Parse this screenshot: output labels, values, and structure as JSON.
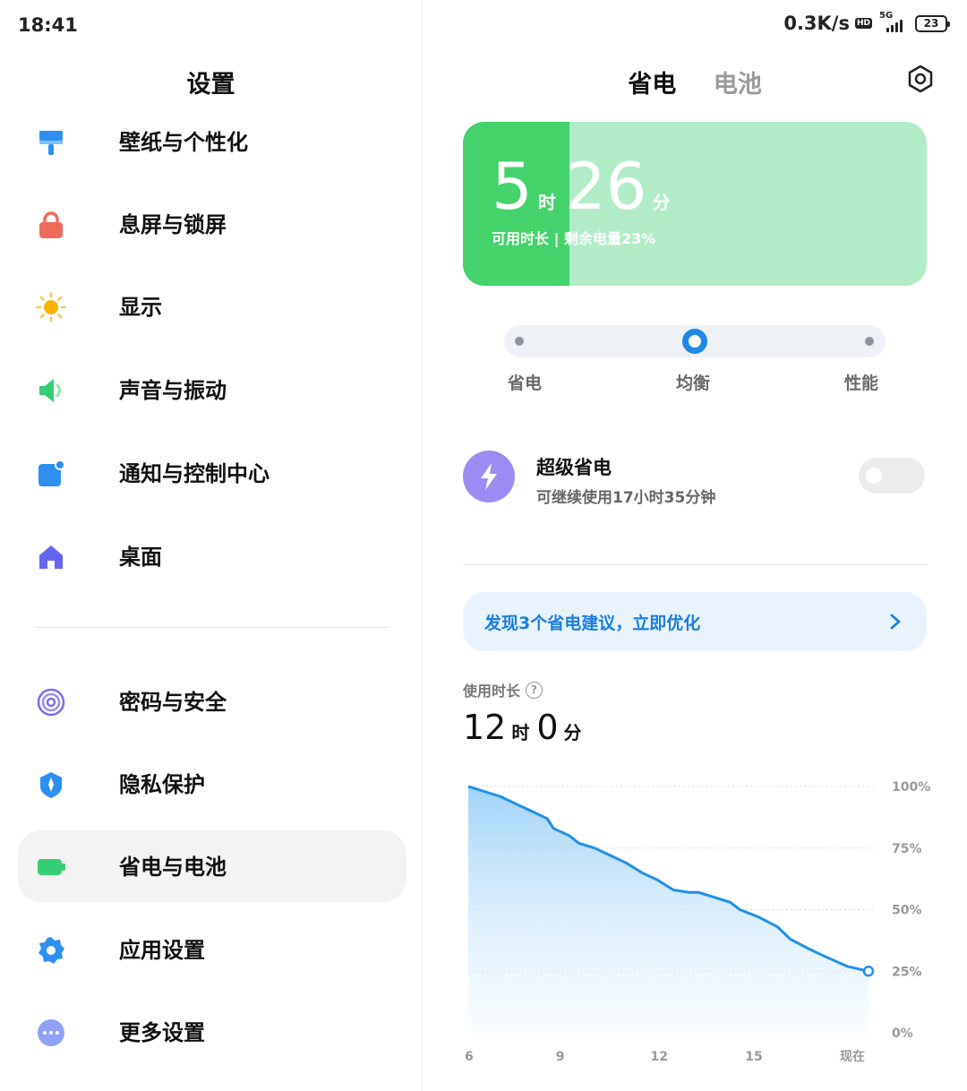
{
  "status_bar": {
    "time": "18:41",
    "net_speed": "0.3K/s",
    "hd": "HD",
    "network": "5G",
    "battery": "23"
  },
  "left": {
    "title": "设置",
    "menu": [
      {
        "label": "壁纸与个性化",
        "icon": "paintbrush-icon",
        "color": "#2d8ff0"
      },
      {
        "label": "息屏与锁屏",
        "icon": "lock-icon",
        "color": "#f06a5a"
      },
      {
        "label": "显示",
        "icon": "sun-icon",
        "color": "#f7b500"
      },
      {
        "label": "声音与振动",
        "icon": "speaker-icon",
        "color": "#35cf73"
      },
      {
        "label": "通知与控制中心",
        "icon": "notification-icon",
        "color": "#2d8ff0"
      },
      {
        "label": "桌面",
        "icon": "home-icon",
        "color": "#6466f1"
      },
      {
        "label": "密码与安全",
        "icon": "fingerprint-icon",
        "color": "#7b6cf2"
      },
      {
        "label": "隐私保护",
        "icon": "shield-icon",
        "color": "#2d8ff0"
      },
      {
        "label": "省电与电池",
        "icon": "battery-icon",
        "color": "#35cf73",
        "active": true
      },
      {
        "label": "应用设置",
        "icon": "gear-icon",
        "color": "#2d8ff0"
      },
      {
        "label": "更多设置",
        "icon": "more-icon",
        "color": "#8fa1f7"
      }
    ]
  },
  "right": {
    "tabs": [
      "省电",
      "电池"
    ],
    "active_tab": 0,
    "card": {
      "hours": "5",
      "hour_unit": "时",
      "minutes": "26",
      "minute_unit": "分",
      "subtitle": "可用时长 | 剩余电量23%",
      "battery_fraction": 0.23
    },
    "modes": [
      "省电",
      "均衡",
      "性能"
    ],
    "selected_mode": 1,
    "super_saver": {
      "title": "超级省电",
      "subtitle": "可继续使用17小时35分钟",
      "enabled": false
    },
    "tip": "发现3个省电建议，立即优化",
    "usage": {
      "label": "使用时长",
      "hours": "12",
      "hour_unit": "时",
      "minutes": "0",
      "minute_unit": "分"
    }
  },
  "chart_data": {
    "type": "area",
    "x_tick_labels": [
      "6",
      "9",
      "12",
      "15",
      "现在"
    ],
    "y_tick_labels": [
      "100%",
      "75%",
      "50%",
      "25%",
      "0%"
    ],
    "ylim": [
      0,
      100
    ],
    "xlim": [
      6,
      18.68
    ],
    "grid": true,
    "color": "#1e90e8",
    "x": [
      6,
      6.5,
      7,
      7.5,
      8,
      8.5,
      8.7,
      9.2,
      9.5,
      10,
      10.5,
      11,
      11.5,
      12,
      12.5,
      13,
      13.3,
      13.8,
      14.3,
      14.6,
      15.2,
      15.8,
      16.2,
      16.8,
      17.3,
      18,
      18.68
    ],
    "y": [
      100,
      98,
      96,
      93,
      90,
      87,
      83,
      80,
      77,
      75,
      72,
      69,
      65,
      62,
      58,
      57,
      57,
      55,
      53,
      50,
      47,
      43,
      38,
      34,
      31,
      27,
      25
    ]
  }
}
